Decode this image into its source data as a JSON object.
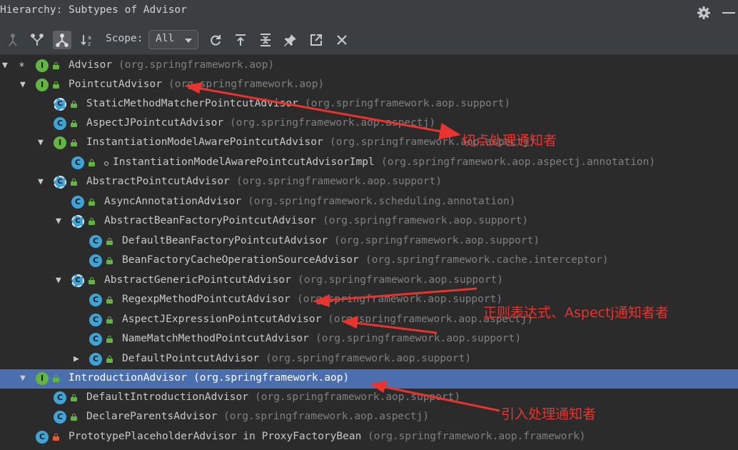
{
  "window": {
    "title": "Hierarchy: Subtypes of Advisor",
    "gear_icon": "gear-icon",
    "minimize_icon": "minimize-icon"
  },
  "toolbar": {
    "buttons": [
      {
        "name": "supertypes-hierarchy-button",
        "icon": "hierarchy-up-icon"
      },
      {
        "name": "subtypes-hierarchy-button",
        "icon": "hierarchy-merge-icon"
      },
      {
        "name": "class-hierarchy-button",
        "icon": "hierarchy-tree-icon",
        "active": true
      },
      {
        "name": "sort-alphabetically-button",
        "icon": "sort-alpha-icon"
      }
    ],
    "scope_label": "Scope:",
    "scope_value": "All",
    "actions": [
      "refresh-icon",
      "expand-icon",
      "collapse-all-icon",
      "pin-icon",
      "export-icon",
      "close-icon"
    ]
  },
  "tree": {
    "rows": [
      {
        "class": "Advisor",
        "package": "(org.springframework.aop)",
        "icon": "I",
        "expanded": true,
        "root_star": true
      },
      {
        "class": "PointcutAdvisor",
        "package": "(org.springframework.aop)",
        "icon": "I",
        "expanded": true
      },
      {
        "class": "StaticMethodMatcherPointcutAdvisor",
        "package": "(org.springframework.aop.support)",
        "icon": "abstract-class"
      },
      {
        "class": "AspectJPointcutAdvisor",
        "package": "(org.springframework.aop.aspectj)",
        "icon": "C"
      },
      {
        "class": "InstantiationModelAwarePointcutAdvisor",
        "package": "(org.springframework.aop.aspectj)",
        "icon": "I",
        "expanded": true
      },
      {
        "class": "InstantiationModelAwarePointcutAdvisorImpl",
        "package": "(org.springframework.aop.aspectj.annotation)",
        "icon": "C"
      },
      {
        "class": "AbstractPointcutAdvisor",
        "package": "(org.springframework.aop.support)",
        "icon": "abstract-class",
        "expanded": true
      },
      {
        "class": "AsyncAnnotationAdvisor",
        "package": "(org.springframework.scheduling.annotation)",
        "icon": "C"
      },
      {
        "class": "AbstractBeanFactoryPointcutAdvisor",
        "package": "(org.springframework.aop.support)",
        "icon": "abstract-class",
        "expanded": true
      },
      {
        "class": "DefaultBeanFactoryPointcutAdvisor",
        "package": "(org.springframework.aop.support)",
        "icon": "C"
      },
      {
        "class": "BeanFactoryCacheOperationSourceAdvisor",
        "package": "(org.springframework.cache.interceptor)",
        "icon": "C"
      },
      {
        "class": "AbstractGenericPointcutAdvisor",
        "package": "(org.springframework.aop.support)",
        "icon": "abstract-class",
        "expanded": true
      },
      {
        "class": "RegexpMethodPointcutAdvisor",
        "package": "(org.springframework.aop.support)",
        "icon": "C"
      },
      {
        "class": "AspectJExpressionPointcutAdvisor",
        "package": "(org.springframework.aop.aspectj)",
        "icon": "C"
      },
      {
        "class": "NameMatchMethodPointcutAdvisor",
        "package": "(org.springframework.aop.support)",
        "icon": "C"
      },
      {
        "class": "DefaultPointcutAdvisor",
        "package": "(org.springframework.aop.support)",
        "icon": "C",
        "collapsed": true
      },
      {
        "class": "IntroductionAdvisor",
        "package": "(org.springframework.aop)",
        "icon": "I",
        "expanded": true,
        "selected": true
      },
      {
        "class": "DefaultIntroductionAdvisor",
        "package": "(org.springframework.aop.support)",
        "icon": "C"
      },
      {
        "class": "DeclareParentsAdvisor",
        "package": "(org.springframework.aop.aspectj)",
        "icon": "C"
      },
      {
        "class": "PrototypePlaceholderAdvisor in ProxyFactoryBean",
        "package": "(org.springframework.aop.framework)",
        "icon": "C",
        "visibility": "private"
      }
    ]
  },
  "annotations": [
    {
      "text": "切点处理通知者",
      "color": "#e8332e"
    },
    {
      "text": "正则表达式、Aspectj通知者者",
      "color": "#e8332e"
    },
    {
      "text": "引入处理通知者",
      "color": "#e8332e"
    }
  ],
  "colors": {
    "background": "#2b2b2b",
    "toolbar": "#3c3f41",
    "selection": "#4b6eaf",
    "interface_icon": "#62b543",
    "class_icon": "#40a3d6",
    "annotation": "#e8332e"
  }
}
